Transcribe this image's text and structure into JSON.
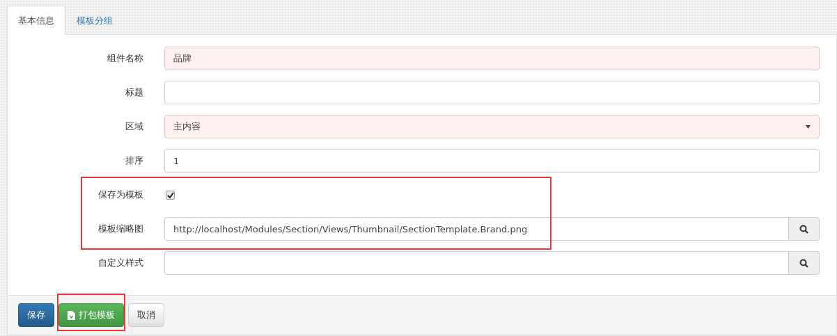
{
  "tabs": [
    {
      "label": "基本信息",
      "selected": true
    },
    {
      "label": "模板分组",
      "selected": false
    }
  ],
  "sections": [
    {
      "highlighted": false,
      "fields": [
        {
          "kind": "text",
          "label": "组件名称",
          "value": "品牌",
          "invalid": true
        },
        {
          "kind": "text",
          "label": "标题",
          "invalid": false
        },
        {
          "kind": "select",
          "label": "区域",
          "value": "主内容",
          "invalid": true
        },
        {
          "kind": "text",
          "label": "排序",
          "value": "1",
          "invalid": false
        }
      ]
    },
    {
      "highlighted": true,
      "fields": [
        {
          "kind": "checkbox",
          "label": "保存为模板",
          "checked": true
        },
        {
          "kind": "search",
          "label": "模板缩略图",
          "value": "http://localhost/Modules/Section/Views/Thumbnail/SectionTemplate.Brand.png",
          "invalid": false
        }
      ]
    },
    {
      "highlighted": false,
      "fields": [
        {
          "kind": "search",
          "label": "自定义样式",
          "invalid": false
        }
      ]
    }
  ],
  "buttons": [
    {
      "kind": "primary",
      "label": "保存",
      "highlighted": false
    },
    {
      "kind": "success",
      "label": "打包模板",
      "highlighted": true
    },
    {
      "kind": "default",
      "label": "取消",
      "highlighted": false
    }
  ]
}
